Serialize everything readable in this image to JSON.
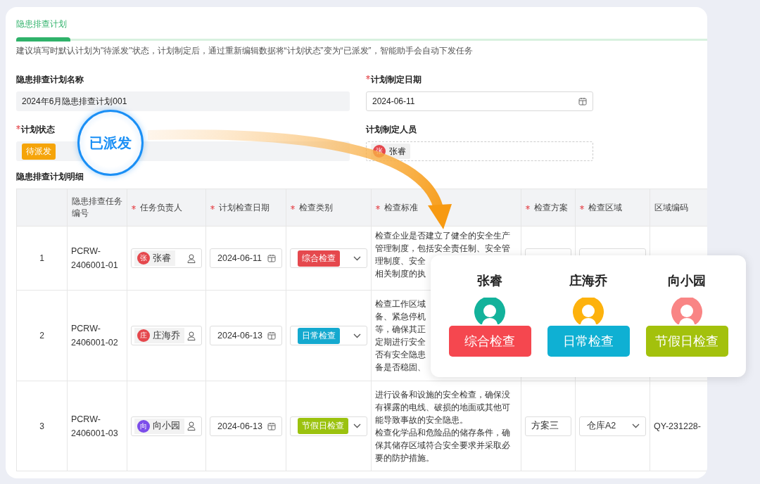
{
  "section": {
    "title": "隐患排查计划",
    "hint": "建议填写时默认计划为\"待派发\"状态，计划制定后，通过重新编辑数据将“计划状态”变为“已派发”，智能助手会自动下发任务"
  },
  "form": {
    "fields": [
      {
        "label": "隐患排查计划名称",
        "kind": "text",
        "value": "2024年6月隐患排查计划001"
      },
      {
        "label": "计划制定日期",
        "required": true,
        "kind": "date",
        "value": "2024-06-11"
      },
      {
        "label": "计划状态",
        "required": true,
        "kind": "status",
        "value": "待派发"
      },
      {
        "label": "计划制定人员",
        "kind": "person",
        "avatar": "张",
        "value": "张睿",
        "color": "#e5484d"
      }
    ]
  },
  "callout": {
    "text": "已派发"
  },
  "table": {
    "title": "隐患排查计划明细",
    "columns": [
      {
        "label": "隐患排查任务编号"
      },
      {
        "label": "任务负责人",
        "required": true
      },
      {
        "label": "计划检查日期",
        "required": true
      },
      {
        "label": "检查类别",
        "required": true
      },
      {
        "label": "检查标准",
        "required": true
      },
      {
        "label": "检查方案",
        "required": true
      },
      {
        "label": "检查区域",
        "required": true
      },
      {
        "label": "区域编码"
      }
    ],
    "rows": [
      {
        "index": "1",
        "code": "PCRW-2406001-01",
        "person": {
          "avatar": "张",
          "name": "张睿",
          "color": "#e5484d"
        },
        "date": "2024-06-11",
        "category": {
          "label": "综合检查",
          "color": "#e5484d"
        },
        "standard_lines": [
          "检查企业是否建立了健全的安全生产",
          "管理制度，包括安全责任制、安全管",
          "理制度、安全",
          "相关制度的执"
        ]
      },
      {
        "index": "2",
        "code": "PCRW-2406001-02",
        "person": {
          "avatar": "庄",
          "name": "庄海乔",
          "color": "#e5484d"
        },
        "date": "2024-06-13",
        "category": {
          "label": "日常检查",
          "color": "#14a9cf"
        },
        "standard_lines": [
          "检查工作区域",
          "备、紧急停机",
          "等，确保其正",
          "定期进行安全",
          "否有安全隐患",
          "备是否稳固、"
        ]
      },
      {
        "index": "3",
        "code": "PCRW-2406001-03",
        "person": {
          "avatar": "向",
          "name": "向小园",
          "color": "#7c4dea"
        },
        "date": "2024-06-13",
        "category": {
          "label": "节假日检查",
          "color": "#9bc20e"
        },
        "standard_lines": [
          "进行设备和设施的安全检查，确保没",
          "有裸露的电线、破损的地面或其他可",
          "能导致事故的安全隐患。",
          "检查化学品和危险品的储存条件，确",
          "保其储存区域符合安全要求并采取必",
          "要的防护措施。"
        ],
        "plan": "方案三",
        "area": "仓库A2",
        "area_code": "QY-231228-"
      }
    ]
  },
  "popup": {
    "people": [
      {
        "name": "张睿",
        "avatar": {
          "color": "#13b29b"
        },
        "category": {
          "label": "综合检查",
          "color": "#f5474f"
        }
      },
      {
        "name": "庄海乔",
        "avatar": {
          "color": "#fdb20d"
        },
        "category": {
          "label": "日常检查",
          "color": "#0fb0d3"
        }
      },
      {
        "name": "向小园",
        "avatar": {
          "color": "#f98585"
        },
        "category": {
          "label": "节假日检查",
          "color": "#a3c10c"
        }
      }
    ]
  }
}
